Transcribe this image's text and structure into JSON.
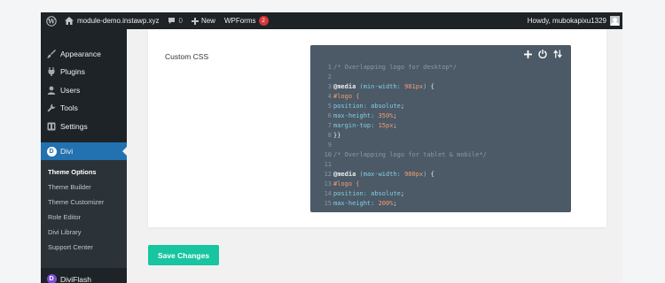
{
  "admin_bar": {
    "site_name": "module-demo.instawp.xyz",
    "comments_count": "0",
    "new_label": "New",
    "wpforms_label": "WPForms",
    "wpforms_badge": "2",
    "greeting": "Howdy, mubokapixu1329"
  },
  "sidebar": {
    "items": [
      {
        "label": "Appearance",
        "icon": "paintbrush-icon"
      },
      {
        "label": "Plugins",
        "icon": "plug-icon"
      },
      {
        "label": "Users",
        "icon": "user-icon"
      },
      {
        "label": "Tools",
        "icon": "wrench-icon"
      },
      {
        "label": "Settings",
        "icon": "settings-icon"
      }
    ],
    "active": {
      "label": "Divi",
      "icon": "divi-icon",
      "badge_letter": "D"
    },
    "submenu": [
      "Theme Options",
      "Theme Builder",
      "Theme Customizer",
      "Role Editor",
      "Divi Library",
      "Support Center"
    ],
    "after": {
      "label": "DiviFlash",
      "badge_letter": "D"
    }
  },
  "panel": {
    "field_label": "Custom CSS",
    "code_lines": [
      {
        "n": "1",
        "text": "/* Overlapping logo for desktop*/"
      },
      {
        "n": "2",
        "text": ""
      },
      {
        "n": "3",
        "text": "@media (min-width: 981px) {"
      },
      {
        "n": "4",
        "text": "#logo {"
      },
      {
        "n": "5",
        "text": "position: absolute;"
      },
      {
        "n": "6",
        "text": "max-height: 350%;"
      },
      {
        "n": "7",
        "text": "margin-top: 15px;"
      },
      {
        "n": "8",
        "text": "}}"
      },
      {
        "n": "9",
        "text": ""
      },
      {
        "n": "10",
        "text": "/* Overlapping logo for tablet & mobile*/"
      },
      {
        "n": "11",
        "text": ""
      },
      {
        "n": "12",
        "text": "@media (max-width: 980px) {"
      },
      {
        "n": "13",
        "text": "#logo {"
      },
      {
        "n": "14",
        "text": "position: absolute;"
      },
      {
        "n": "15",
        "text": "max-height: 200%;"
      }
    ]
  },
  "save_button": "Save Changes",
  "colors": {
    "admin_bar": "#1d2327",
    "active_menu": "#2271b1",
    "editor_bg": "#4c5966",
    "save_button": "#17c5a0",
    "badge": "#d63638"
  }
}
